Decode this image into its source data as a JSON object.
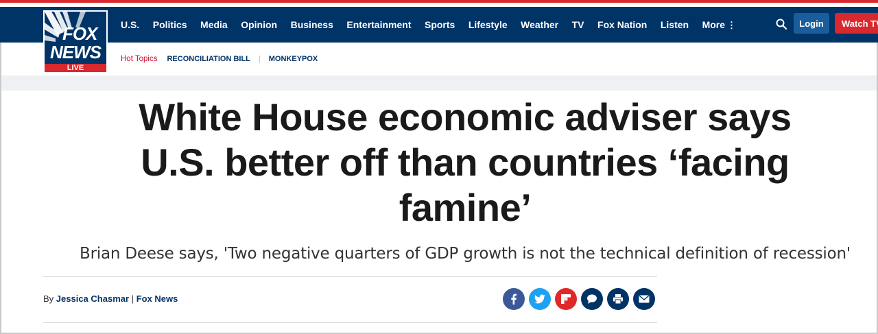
{
  "logo": {
    "fox": "FOX",
    "news": "NEWS",
    "live": "LIVE"
  },
  "nav": {
    "items": [
      "U.S.",
      "Politics",
      "Media",
      "Opinion",
      "Business",
      "Entertainment",
      "Sports",
      "Lifestyle",
      "Weather",
      "TV",
      "Fox Nation",
      "Listen",
      "More"
    ],
    "login": "Login",
    "watch": "Watch TV"
  },
  "subnav": {
    "label": "Hot Topics",
    "topics": [
      "RECONCILIATION BILL",
      "MONKEYPOX"
    ]
  },
  "article": {
    "headline": "White House economic adviser says U.S. better off than countries ‘facing famine’",
    "subheadline": "Brian Deese says, 'Two negative quarters of GDP growth is not the technical definition of recession'",
    "byline_prefix": "By",
    "author": "Jessica Chasmar",
    "outlet": "Fox News"
  },
  "share": [
    {
      "icon": "facebook-icon",
      "color": "#3b5998"
    },
    {
      "icon": "twitter-icon",
      "color": "#1da1f2"
    },
    {
      "icon": "flipboard-icon",
      "color": "#e12828"
    },
    {
      "icon": "comment-icon",
      "color": "#003366"
    },
    {
      "icon": "print-icon",
      "color": "#003366"
    },
    {
      "icon": "email-icon",
      "color": "#003366"
    }
  ],
  "colors": {
    "brand_blue": "#003366",
    "brand_red": "#d7292e",
    "login_blue": "#1a5d9c"
  }
}
